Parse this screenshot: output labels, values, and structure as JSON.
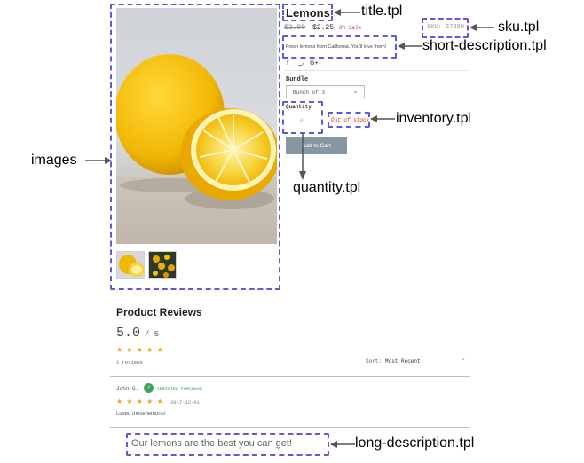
{
  "product": {
    "title": "Lemons",
    "price_original": "$3.00",
    "price_sale": "$2.25",
    "sale_badge": "On Sale",
    "sku": "SKU: 67890",
    "short_description": "Fresh lemons from California. You'll love them!",
    "social_icons": [
      "f",
      "🐦",
      "G+"
    ],
    "bundle_label": "Bundle",
    "bundle_selected": "Bunch of 3",
    "quantity_label": "Quantity",
    "quantity_value": "0",
    "inventory_status": "Out of stock",
    "add_to_cart": "Add to Cart",
    "long_description": "Our lemons are the best you can get!"
  },
  "reviews": {
    "heading": "Product Reviews",
    "score": "5.0",
    "score_max": "/ 5",
    "stars": "★ ★ ★ ★ ★",
    "count": "1 reviews",
    "sort_label": "Sort:",
    "sort_value": "Most Recent",
    "items": [
      {
        "author": "John G.",
        "badge": "VERIFIED PURCHASE",
        "stars": "★ ★ ★ ★ ★",
        "date": "2017-12-01",
        "text": "Loved these lemons!"
      }
    ]
  },
  "annotations": {
    "images": "images",
    "title": "title.tpl",
    "sku": "sku.tpl",
    "short_description": "short-description.tpl",
    "inventory": "inventory.tpl",
    "quantity": "quantity.tpl",
    "long_description": "long-description.tpl"
  },
  "colors": {
    "annotation_border": "#5b5bdc",
    "star": "#f0a020",
    "sale": "#d93025",
    "verified": "#3aa55a",
    "button": "#8796a3"
  }
}
